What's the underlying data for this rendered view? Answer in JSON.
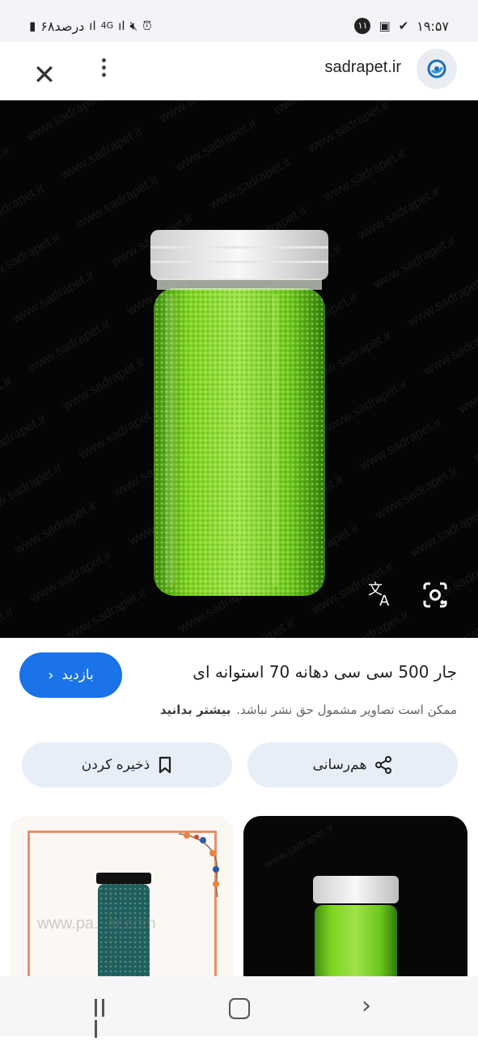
{
  "status_bar": {
    "time": "۱۹:۵۷",
    "notification_count": "۱۱",
    "battery_text": "۶۸درصد",
    "network": "4G"
  },
  "header": {
    "site_name": "sadrapet.ir"
  },
  "image": {
    "watermark": "www.sadrapet.ir"
  },
  "info": {
    "visit_label": "بازدید",
    "title": "جار 500 سی سی دهانه 70 استوانه ای",
    "copyright_text": "ممکن است تصاویر مشمول حق نشر نباشد.",
    "learn_more": "بیشتر بدانید",
    "share_label": "هم‌رسانی",
    "save_label": "ذخیره کردن"
  },
  "related": {
    "left_watermark": "www.pa...ar.com",
    "right_watermark": "www.sadrapet.ir"
  },
  "colors": {
    "accent": "#1a73e8",
    "action_bg": "#e8eef8",
    "image_bg": "#050505"
  }
}
